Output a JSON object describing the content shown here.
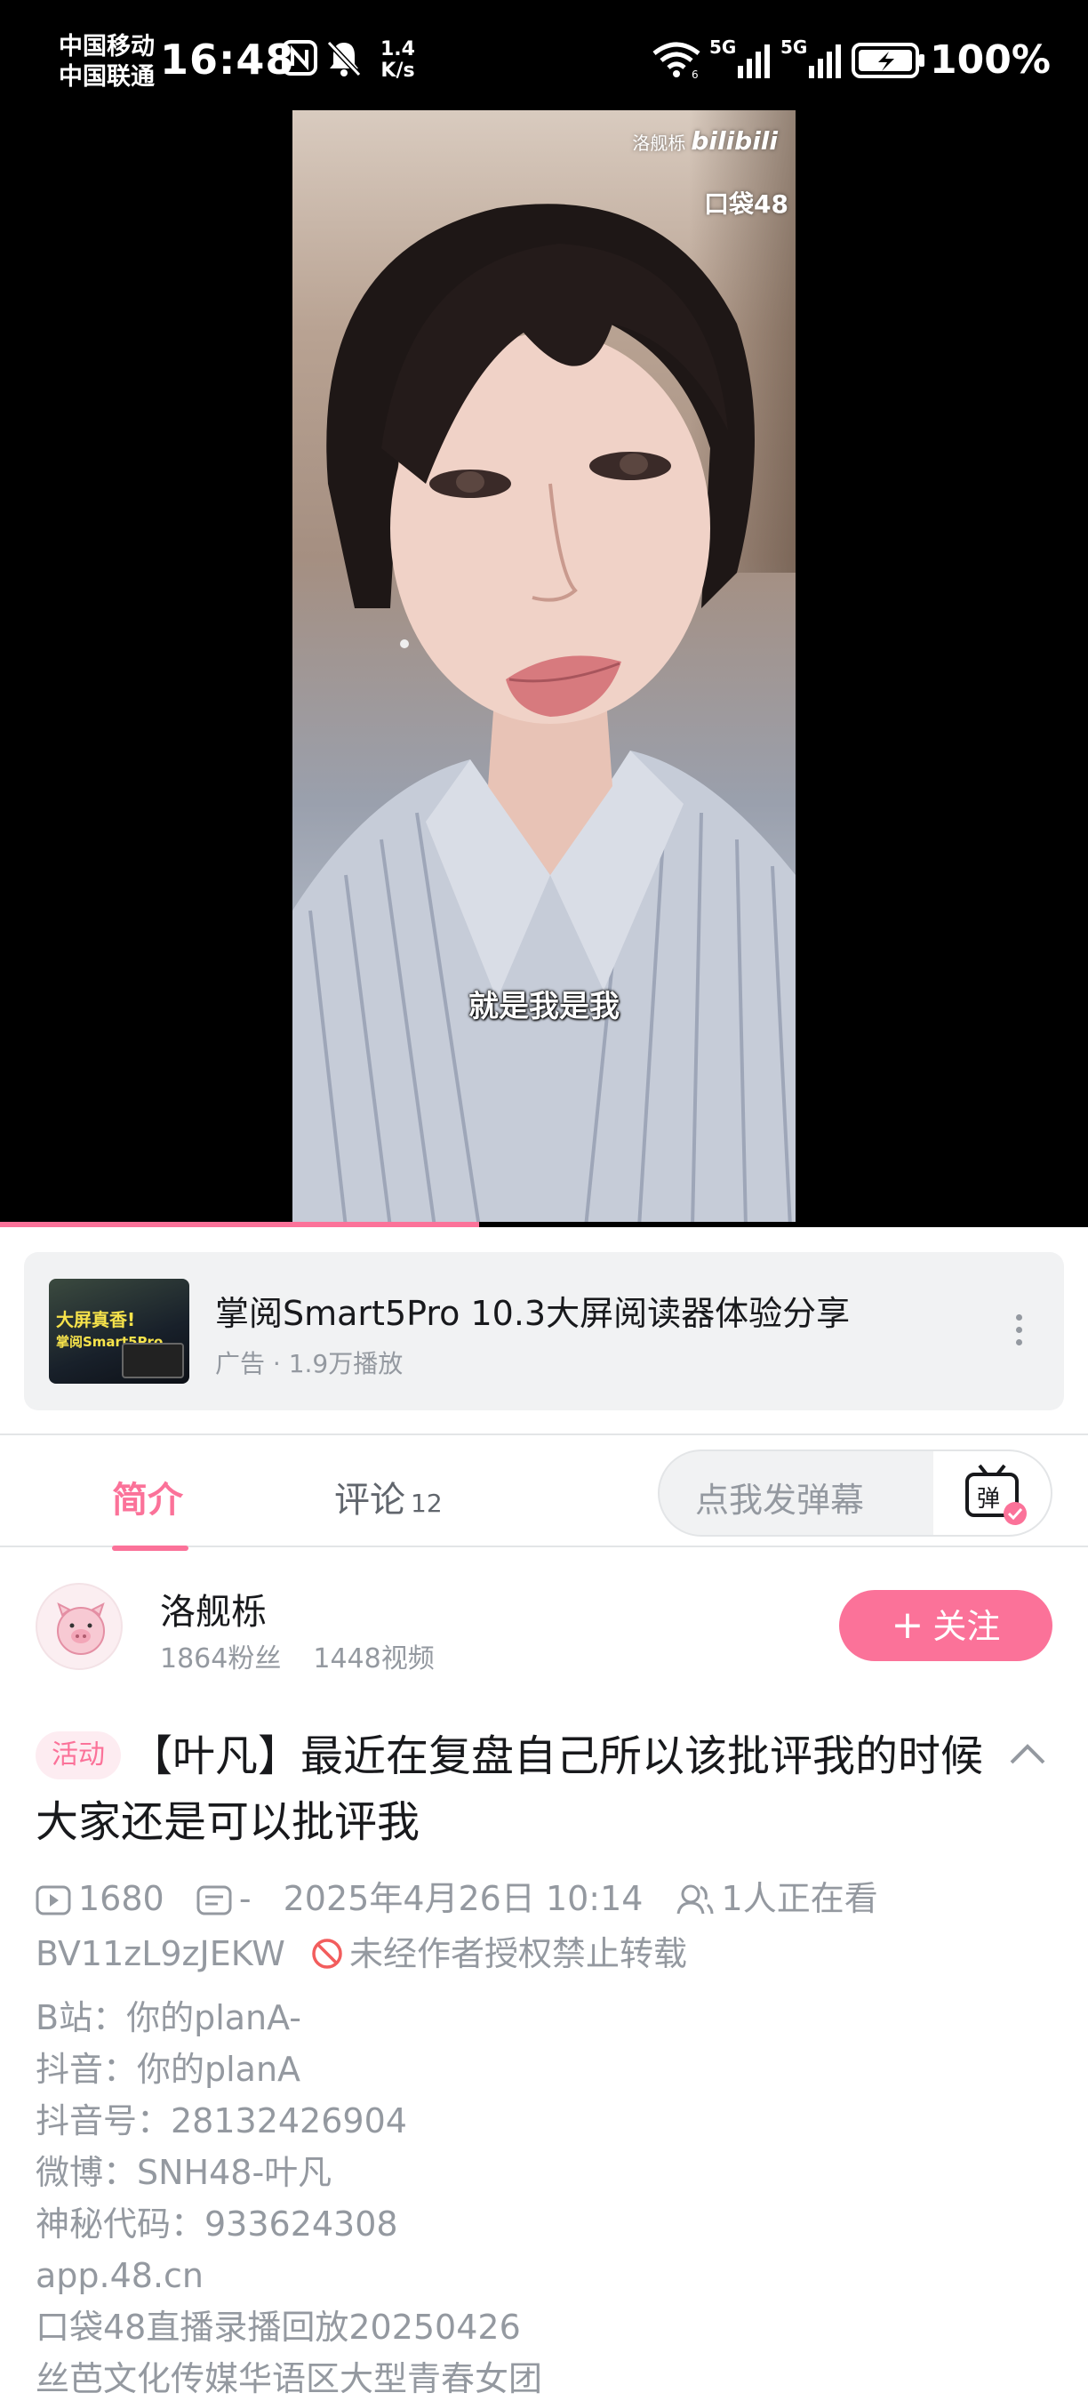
{
  "status_bar": {
    "carrier_1": "中国移动",
    "carrier_2": "中国联通",
    "time": "16:48",
    "net_speed_value": "1.4",
    "net_speed_unit": "K/s",
    "signal_1_label": "5G",
    "signal_2_label": "5G",
    "battery": "100%",
    "icons": [
      "nfc-icon",
      "mute-icon",
      "wifi-icon",
      "signal-icon",
      "battery-icon"
    ]
  },
  "video": {
    "watermark_uploader": "洛舰栎",
    "watermark_brand": "bilibili",
    "watermark_app": "口袋48",
    "subtitle": "就是我是我",
    "progress_fraction": 0.44
  },
  "ad": {
    "thumb_text_1": "大屏真香!",
    "thumb_text_2": "掌阅Smart5Pro",
    "title": "掌阅Smart5Pro 10.3大屏阅读器体验分享",
    "meta": "广告 · 1.9万播放"
  },
  "tabs": {
    "intro": "简介",
    "comments": "评论",
    "comments_count": "12",
    "danmaku_placeholder": "点我发弹幕",
    "danmaku_button": "弹"
  },
  "uploader": {
    "name": "洛舰栎",
    "fans": "1864粉丝",
    "videos": "1448视频",
    "follow_label": "关注"
  },
  "video_info": {
    "badge": "活动",
    "title": "【叶凡】最近在复盘自己所以该批评我的时候大家还是可以批评我",
    "plays": "1680",
    "danmaku_count": "-",
    "date": "2025年4月26日 10:14",
    "watching": "1人正在看",
    "bvid": "BV11zL9zJEKW",
    "copyright": "未经作者授权禁止转载"
  },
  "description": [
    "B站：你的planA-",
    "抖音：你的planA",
    "抖音号：28132426904",
    "微博：SNH48-叶凡",
    "神秘代码：933624308",
    "app.48.cn",
    "口袋48直播录播回放20250426",
    "丝芭文化传媒华语区大型青春女团"
  ],
  "colors": {
    "accent": "#fb7299",
    "text_primary": "#18191c",
    "text_secondary": "#9499a0",
    "card_bg": "#f1f2f3"
  }
}
